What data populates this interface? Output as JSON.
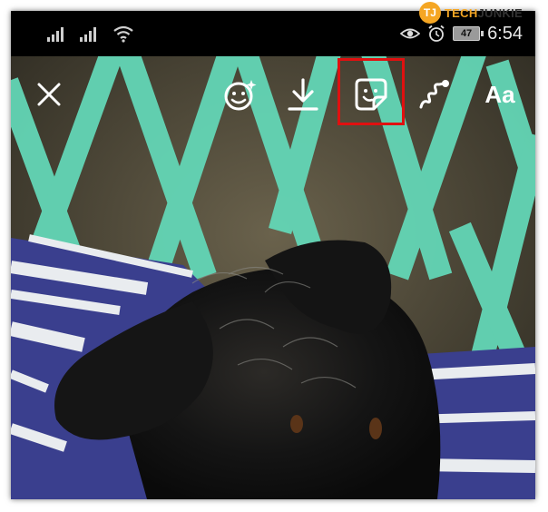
{
  "watermark": {
    "logo_letters": "TJ",
    "brand_part1": "TECH",
    "brand_part2": "JUNKIE"
  },
  "status_bar": {
    "time": "6:54",
    "battery_level": "47",
    "icons": [
      "signal-icon",
      "signal-icon",
      "wifi-icon",
      "eye-icon",
      "alarm-icon",
      "battery-icon"
    ]
  },
  "toolbar": {
    "close_icon": "close-icon",
    "face_effects_icon": "face-sparkle-icon",
    "download_icon": "download-icon",
    "sticker_icon": "sticker-icon",
    "draw_icon": "draw-squiggle-icon",
    "text_label": "Aa"
  },
  "highlight": {
    "target": "sticker-icon",
    "color": "#e01010"
  }
}
